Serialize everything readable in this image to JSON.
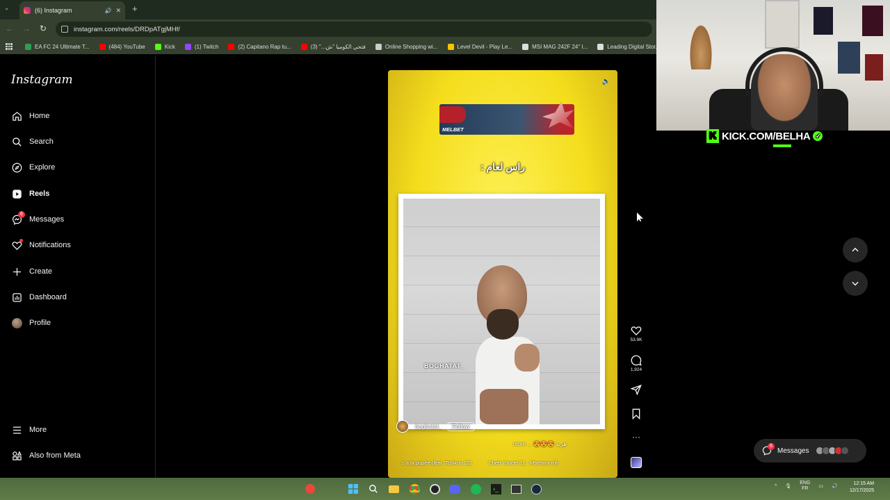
{
  "browser": {
    "tab_title": "(6) Instagram",
    "url": "instagram.com/reels/DRDpATgjMHf/",
    "new_tab": "+",
    "bookmarks": [
      {
        "label": "EA FC 24 Ultimate T...",
        "color": "#2f9e56"
      },
      {
        "label": "(484) YouTube",
        "color": "#ff0000"
      },
      {
        "label": "Kick",
        "color": "#53fc18"
      },
      {
        "label": "(1) Twitch",
        "color": "#9146ff"
      },
      {
        "label": "(2) Capitano Rap tu...",
        "color": "#ff0000"
      },
      {
        "label": "فتحي الكوميا \"ش...\" (3)",
        "color": "#ff0000"
      },
      {
        "label": "Online Shopping wi...",
        "color": "#cccccc"
      },
      {
        "label": "Level Devil - Play Le...",
        "color": "#f5c400"
      },
      {
        "label": "MSI MAG 242F 24\" I...",
        "color": "#dddddd"
      },
      {
        "label": "Leading Digital Stor...",
        "color": "#dddddd"
      }
    ]
  },
  "sidebar": {
    "logo": "Instagram",
    "items": [
      {
        "label": "Home",
        "icon": "home-icon"
      },
      {
        "label": "Search",
        "icon": "search-icon"
      },
      {
        "label": "Explore",
        "icon": "compass-icon"
      },
      {
        "label": "Reels",
        "icon": "reels-icon"
      },
      {
        "label": "Messages",
        "icon": "messenger-icon",
        "badge": "6"
      },
      {
        "label": "Notifications",
        "icon": "heart-icon"
      },
      {
        "label": "Create",
        "icon": "plus-icon"
      },
      {
        "label": "Dashboard",
        "icon": "dashboard-icon"
      },
      {
        "label": "Profile",
        "icon": "avatar"
      }
    ],
    "more": "More",
    "also_from_meta": "Also from Meta"
  },
  "reel": {
    "ad_brand": "MELBET",
    "caption_arabic": "راس لعام :",
    "watermark": "BOGHATAT_",
    "author": "boghatat_",
    "follow": "Follow",
    "description": "more ... 😍😍😍 هربة",
    "audio_1": "♫ a la pupée (feat. Tchikou 22)",
    "audio_2": "Cheb Youcef 31 - Msemya roh"
  },
  "actions": {
    "likes": "53.9K",
    "comments": "1,924"
  },
  "overlay": {
    "kick_text": "KICK.COM/BELHA",
    "kick_letter": "K"
  },
  "messages_pill": {
    "label": "Messages",
    "badge": "6"
  },
  "taskbar": {
    "lang_top": "ENG",
    "lang_bottom": "FR",
    "time": "12:15 AM",
    "date": "12/17/2025"
  },
  "colors": {
    "instagram_badge": "#ff3040",
    "kick_green": "#53fc18",
    "reel_yellow": "#f4dd1c"
  }
}
